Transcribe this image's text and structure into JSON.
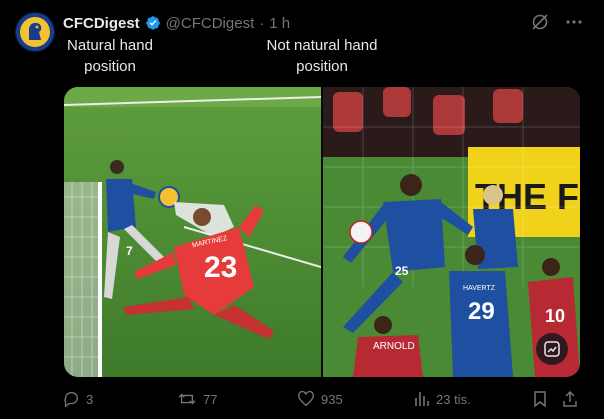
{
  "author": {
    "name": "CFCDigest",
    "handle": "@CFCDigest",
    "separator": "·",
    "time": "1 h"
  },
  "captions": {
    "left": "Natural hand position",
    "right": "Not natural hand position"
  },
  "media": {
    "left_panel": {
      "goalkeeper_number": "23",
      "goalkeeper_name": "MARTINEZ",
      "attacker_number": "7"
    },
    "right_panel": {
      "banner_text": "THE F",
      "player_number_a": "25",
      "player_number_b": "29",
      "player_name_b": "HAVERTZ",
      "opponent_number": "10",
      "opponent_back": "ARNOLD"
    }
  },
  "actions": {
    "replies": "3",
    "reposts": "77",
    "likes": "935",
    "views": "23 tis."
  },
  "colors": {
    "background": "#000000",
    "text": "#e7e9ea",
    "muted": "#71767b",
    "verified": "#1d9bf0",
    "chelsea_blue": "#1f4fa0",
    "keeper_red": "#e53b3b",
    "pitch_green": "#3f8a2f"
  },
  "icons": {
    "verified": "verified-badge-icon",
    "grok": "grok-icon",
    "more": "more-icon",
    "reply": "reply-icon",
    "repost": "repost-icon",
    "like": "like-icon",
    "views": "views-icon",
    "bookmark": "bookmark-icon",
    "share": "share-icon",
    "image_action": "image-edit-icon"
  }
}
